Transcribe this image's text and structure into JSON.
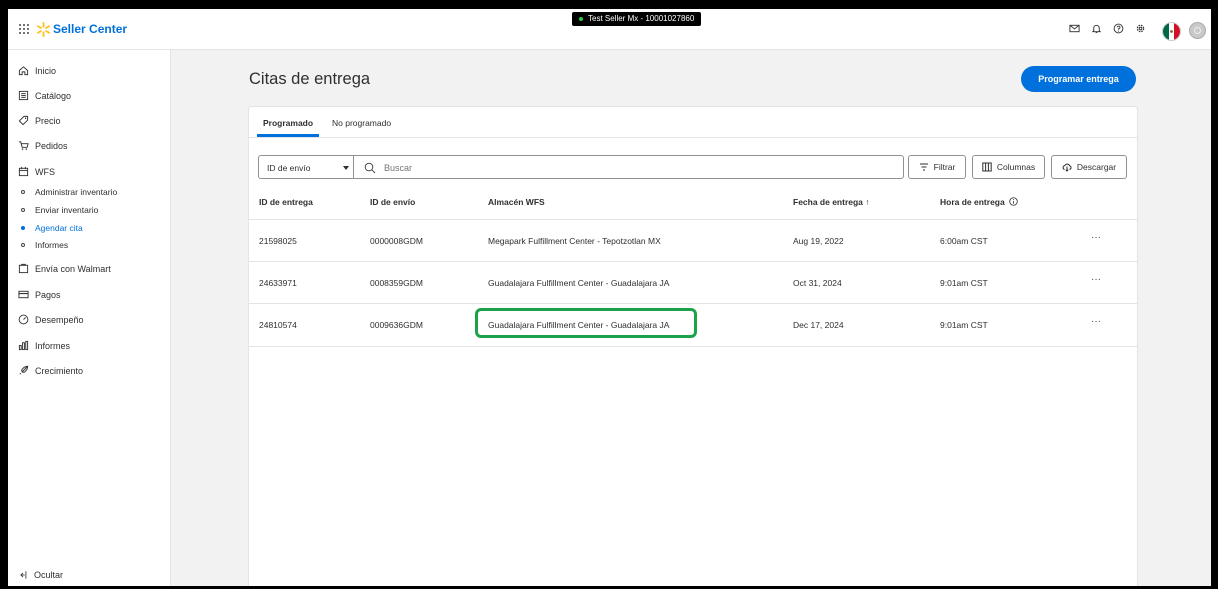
{
  "header": {
    "brand": "Seller Center",
    "seller_badge": "Test Seller Mx - 10001027860"
  },
  "sidebar": {
    "items": [
      {
        "label": "Inicio",
        "icon": "home-icon"
      },
      {
        "label": "Catálogo",
        "icon": "catalog-icon"
      },
      {
        "label": "Precio",
        "icon": "tag-icon"
      },
      {
        "label": "Pedidos",
        "icon": "cart-icon"
      },
      {
        "label": "WFS",
        "icon": "wfs-icon"
      }
    ],
    "wfs_subitems": [
      {
        "label": "Administrar inventario",
        "active": false
      },
      {
        "label": "Enviar inventario",
        "active": false
      },
      {
        "label": "Agendar cita",
        "active": true
      },
      {
        "label": "Informes",
        "active": false
      }
    ],
    "items_bottom": [
      {
        "label": "Envía con Walmart",
        "icon": "shipping-icon"
      },
      {
        "label": "Pagos",
        "icon": "payments-icon"
      },
      {
        "label": "Desempeño",
        "icon": "performance-icon"
      },
      {
        "label": "Informes",
        "icon": "reports-icon"
      },
      {
        "label": "Crecimiento",
        "icon": "growth-icon"
      }
    ],
    "hide_label": "Ocultar"
  },
  "main": {
    "title": "Citas de entrega",
    "primary_button": "Programar entrega",
    "tabs": [
      {
        "label": "Programado",
        "active": true
      },
      {
        "label": "No programado",
        "active": false
      }
    ],
    "filter_select": "ID de envío",
    "search_placeholder": "Buscar",
    "buttons": {
      "filter": "Filtrar",
      "columns": "Columnas",
      "download": "Descargar"
    },
    "table": {
      "headers": [
        "ID de entrega",
        "ID de envío",
        "Almacén WFS",
        "Fecha de entrega ↑",
        "Hora de entrega"
      ],
      "rows": [
        {
          "delivery_id": "21598025",
          "shipment_id": "0000008GDM",
          "warehouse": "Megapark Fulfillment Center - Tepotzotlan MX",
          "date": "Aug 19, 2022",
          "time": "6:00am CST"
        },
        {
          "delivery_id": "24633971",
          "shipment_id": "0008359GDM",
          "warehouse": "Guadalajara Fulfillment Center - Guadalajara JA",
          "date": "Oct 31, 2024",
          "time": "9:01am CST"
        },
        {
          "delivery_id": "24810574",
          "shipment_id": "0009636GDM",
          "warehouse": "Guadalajara Fulfillment Center - Guadalajara JA",
          "date": "Dec 17, 2024",
          "time": "9:01am CST"
        }
      ],
      "more_label": "···"
    }
  },
  "colors": {
    "accent": "#0071dc",
    "highlight": "#1ca34a",
    "background": "#f2f2f2"
  }
}
